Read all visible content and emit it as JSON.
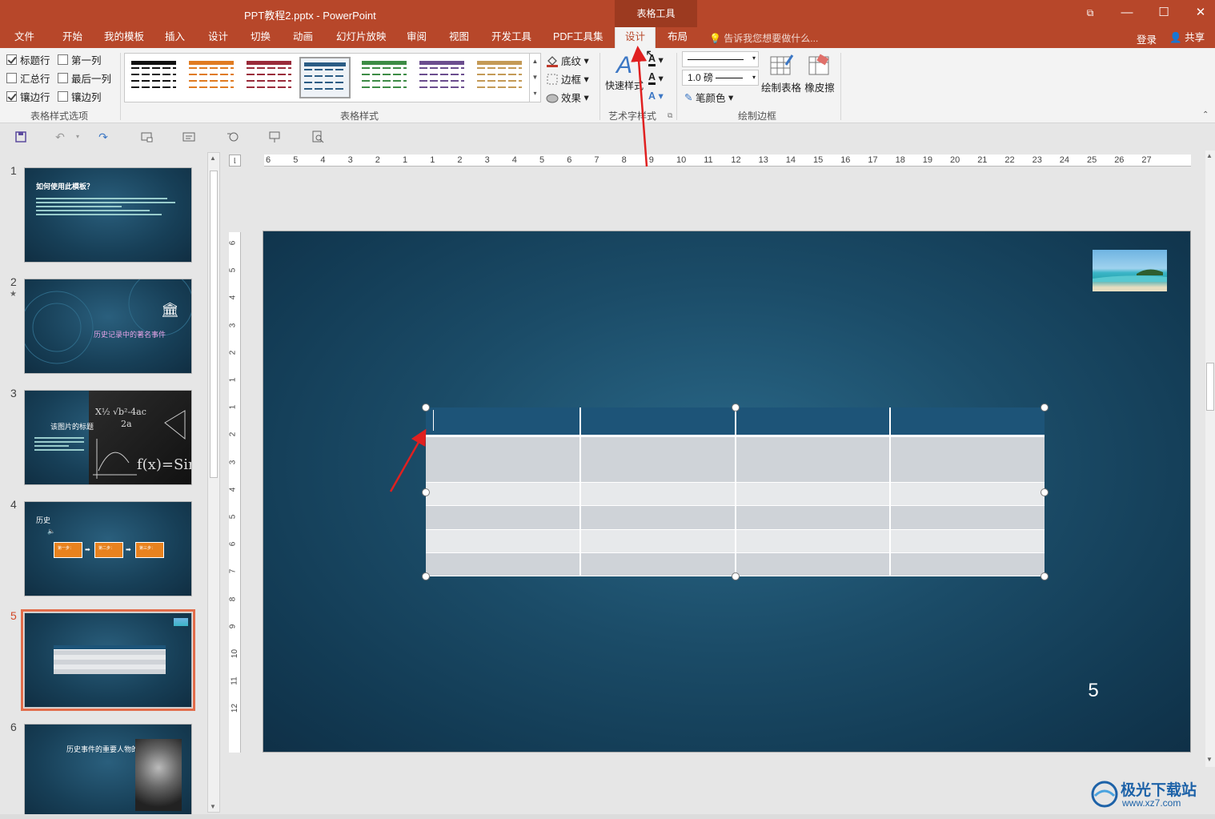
{
  "window": {
    "title": "PPT教程2.pptx - PowerPoint",
    "context_group": "表格工具",
    "buttons": {
      "restore_ribbon": "⧉",
      "minimize": "—",
      "maximize": "☐",
      "close": "✕"
    }
  },
  "tabs": [
    {
      "label": "文件",
      "active": false
    },
    {
      "label": "开始",
      "active": false
    },
    {
      "label": "我的模板",
      "active": false
    },
    {
      "label": "插入",
      "active": false
    },
    {
      "label": "设计",
      "active": false
    },
    {
      "label": "切换",
      "active": false
    },
    {
      "label": "动画",
      "active": false
    },
    {
      "label": "幻灯片放映",
      "active": false
    },
    {
      "label": "审阅",
      "active": false
    },
    {
      "label": "视图",
      "active": false
    },
    {
      "label": "开发工具",
      "active": false
    },
    {
      "label": "PDF工具集",
      "active": false
    },
    {
      "label": "设计",
      "active": true
    },
    {
      "label": "布局",
      "active": false
    }
  ],
  "tell_me": "告诉我您想要做什么...",
  "login": "登录",
  "share": "共享",
  "ribbon": {
    "style_options": {
      "group_label": "表格样式选项",
      "checkboxes": [
        {
          "label": "标题行",
          "checked": true
        },
        {
          "label": "第一列",
          "checked": false
        },
        {
          "label": "汇总行",
          "checked": false
        },
        {
          "label": "最后一列",
          "checked": false
        },
        {
          "label": "镶边行",
          "checked": true
        },
        {
          "label": "镶边列",
          "checked": false
        }
      ]
    },
    "table_styles": {
      "group_label": "表格样式",
      "swatches": [
        "#111111",
        "#e07b21",
        "#9a2b3a",
        "#2b5c85",
        "#3d8c45",
        "#6b4d8e",
        "#c49a56"
      ],
      "selected_index": 3,
      "shading": "底纹",
      "borders": "边框",
      "effects": "效果"
    },
    "wordart": {
      "group_label": "艺术字样式",
      "quick_styles": "快速样式"
    },
    "draw_borders": {
      "group_label": "绘制边框",
      "pen_weight": "1.0 磅",
      "pen_color": "笔颜色",
      "draw_table": "绘制表格",
      "eraser": "橡皮擦"
    }
  },
  "qat": {
    "save": "💾",
    "undo": "↶",
    "redo": "↷"
  },
  "hruler": {
    "ticks": [
      "6",
      "5",
      "4",
      "3",
      "2",
      "1",
      "1",
      "2",
      "3",
      "4",
      "5",
      "6",
      "7",
      "8",
      "9",
      "10",
      "11",
      "12",
      "13",
      "14",
      "15",
      "16",
      "17",
      "18",
      "19",
      "20",
      "21",
      "22",
      "23",
      "24",
      "25",
      "26",
      "27"
    ]
  },
  "vruler": {
    "ticks": [
      "6",
      "5",
      "4",
      "3",
      "2",
      "1",
      "1",
      "2",
      "3",
      "4",
      "5",
      "6",
      "7",
      "8",
      "9",
      "10",
      "11",
      "12"
    ]
  },
  "thumbnails": [
    {
      "number": "1",
      "title": "如何使用此模板？",
      "starred": false
    },
    {
      "number": "2",
      "title": "历史记录中的著名事件",
      "starred": true
    },
    {
      "number": "3",
      "title": "该图片的标题",
      "starred": false
    },
    {
      "number": "4",
      "title": "历史",
      "starred": false,
      "steps": [
        "第一步：",
        "第二步：",
        "第三步："
      ]
    },
    {
      "number": "5",
      "title": "",
      "starred": false,
      "selected": true
    },
    {
      "number": "6",
      "title": "历史事件的重要人物的姓名",
      "starred": false
    }
  ],
  "slide": {
    "number_text": "5",
    "table": {
      "columns": 4,
      "header_rows": 1,
      "body_rows": 5,
      "header_color": "#1d5478",
      "band1": "#cfd3d8",
      "band2": "#e7e9eb"
    }
  },
  "watermark": {
    "brand": "极光下载站",
    "url": "www.xz7.com"
  },
  "colors": {
    "accent": "#b7472a",
    "annotation_arrow": "#e02020"
  }
}
